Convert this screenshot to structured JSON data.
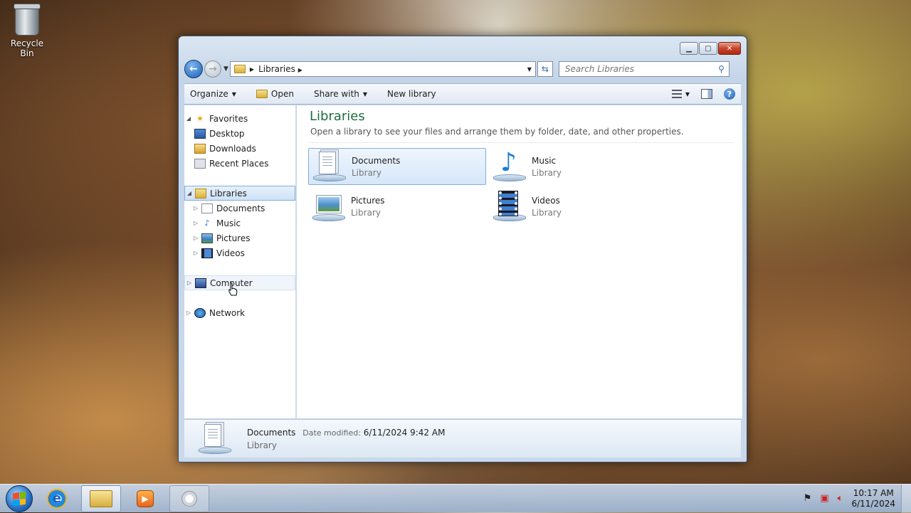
{
  "desktop": {
    "recycle_bin_label": "Recycle Bin"
  },
  "address_bar": {
    "crumb": "Libraries"
  },
  "search": {
    "placeholder": "Search Libraries"
  },
  "toolbar": {
    "organize": "Organize",
    "open": "Open",
    "share_with": "Share with",
    "new_library": "New library"
  },
  "nav_pane": {
    "favorites": "Favorites",
    "favorites_items": [
      "Desktop",
      "Downloads",
      "Recent Places"
    ],
    "libraries": "Libraries",
    "libraries_items": [
      "Documents",
      "Music",
      "Pictures",
      "Videos"
    ],
    "computer": "Computer",
    "network": "Network"
  },
  "content": {
    "title": "Libraries",
    "description": "Open a library to see your files and arrange them by folder, date, and other properties.",
    "items": [
      {
        "name": "Documents",
        "type": "Library"
      },
      {
        "name": "Music",
        "type": "Library"
      },
      {
        "name": "Pictures",
        "type": "Library"
      },
      {
        "name": "Videos",
        "type": "Library"
      }
    ]
  },
  "details": {
    "name": "Documents",
    "date_label": "Date modified:",
    "date_value": "6/11/2024 9:42 AM",
    "type": "Library"
  },
  "taskbar": {
    "time": "10:17 AM",
    "date": "6/11/2024"
  }
}
